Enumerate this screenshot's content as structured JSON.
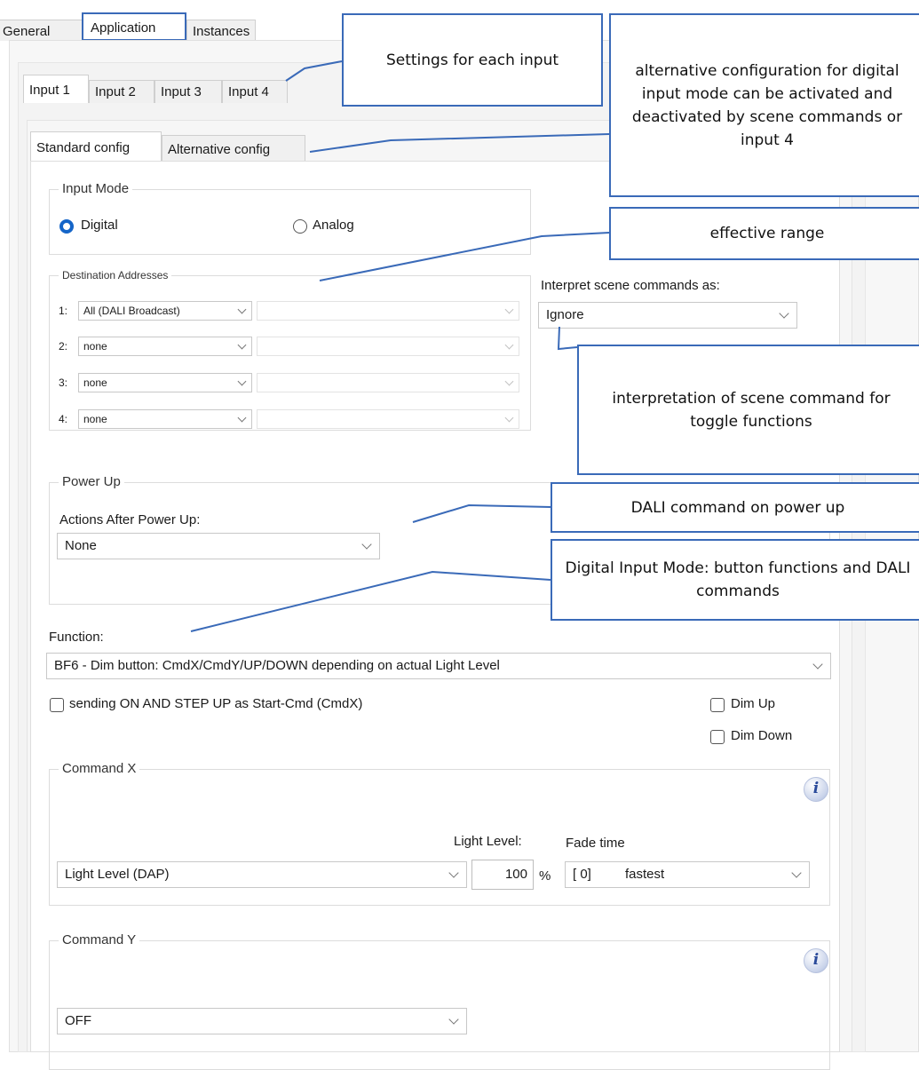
{
  "top_tabs": [
    "General",
    "Application",
    "Instances"
  ],
  "input_tabs": [
    "Input 1",
    "Input 2",
    "Input 3",
    "Input 4"
  ],
  "config_tabs": [
    "Standard config",
    "Alternative config"
  ],
  "input_mode": {
    "title": "Input Mode",
    "options": [
      "Digital",
      "Analog"
    ],
    "selected": "Digital"
  },
  "destination": {
    "title": "Destination Addresses",
    "rows": [
      {
        "num": "1:",
        "value": "All (DALI Broadcast)"
      },
      {
        "num": "2:",
        "value": "none"
      },
      {
        "num": "3:",
        "value": "none"
      },
      {
        "num": "4:",
        "value": "none"
      }
    ]
  },
  "scene": {
    "label": "Interpret scene commands as:",
    "value": "Ignore"
  },
  "power_up": {
    "title": "Power Up",
    "label": "Actions After Power Up:",
    "value": "None"
  },
  "function": {
    "label": "Function:",
    "value": "BF6 - Dim button:  CmdX/CmdY/UP/DOWN depending on actual Light Level",
    "checkbox_start": "sending ON AND STEP UP as Start-Cmd (CmdX)",
    "checkbox_dim_up": "Dim Up",
    "checkbox_dim_down": "Dim Down"
  },
  "command_x": {
    "title": "Command X",
    "light_level_label": "Light Level:",
    "fade_label": "Fade time",
    "command": "Light Level (DAP)",
    "level": "100",
    "unit": "%",
    "fade_code": "[ 0]",
    "fade_value": "fastest"
  },
  "command_y": {
    "title": "Command Y",
    "command": "OFF"
  },
  "info_glyph": "i",
  "callouts": {
    "settings": "Settings for each input",
    "alternative": "alternative configuration for digital input mode can be activated and deactivated by scene commands or input 4",
    "range": "effective range",
    "interpretation": "interpretation of scene command for toggle functions",
    "power": "DALI command on power up",
    "digital": "Digital Input Mode: button functions and DALI commands"
  },
  "colors": {
    "callout_border": "#3a6ab8",
    "radio_selected": "#1565c8",
    "tab_highlight": "#3a6ab8"
  }
}
